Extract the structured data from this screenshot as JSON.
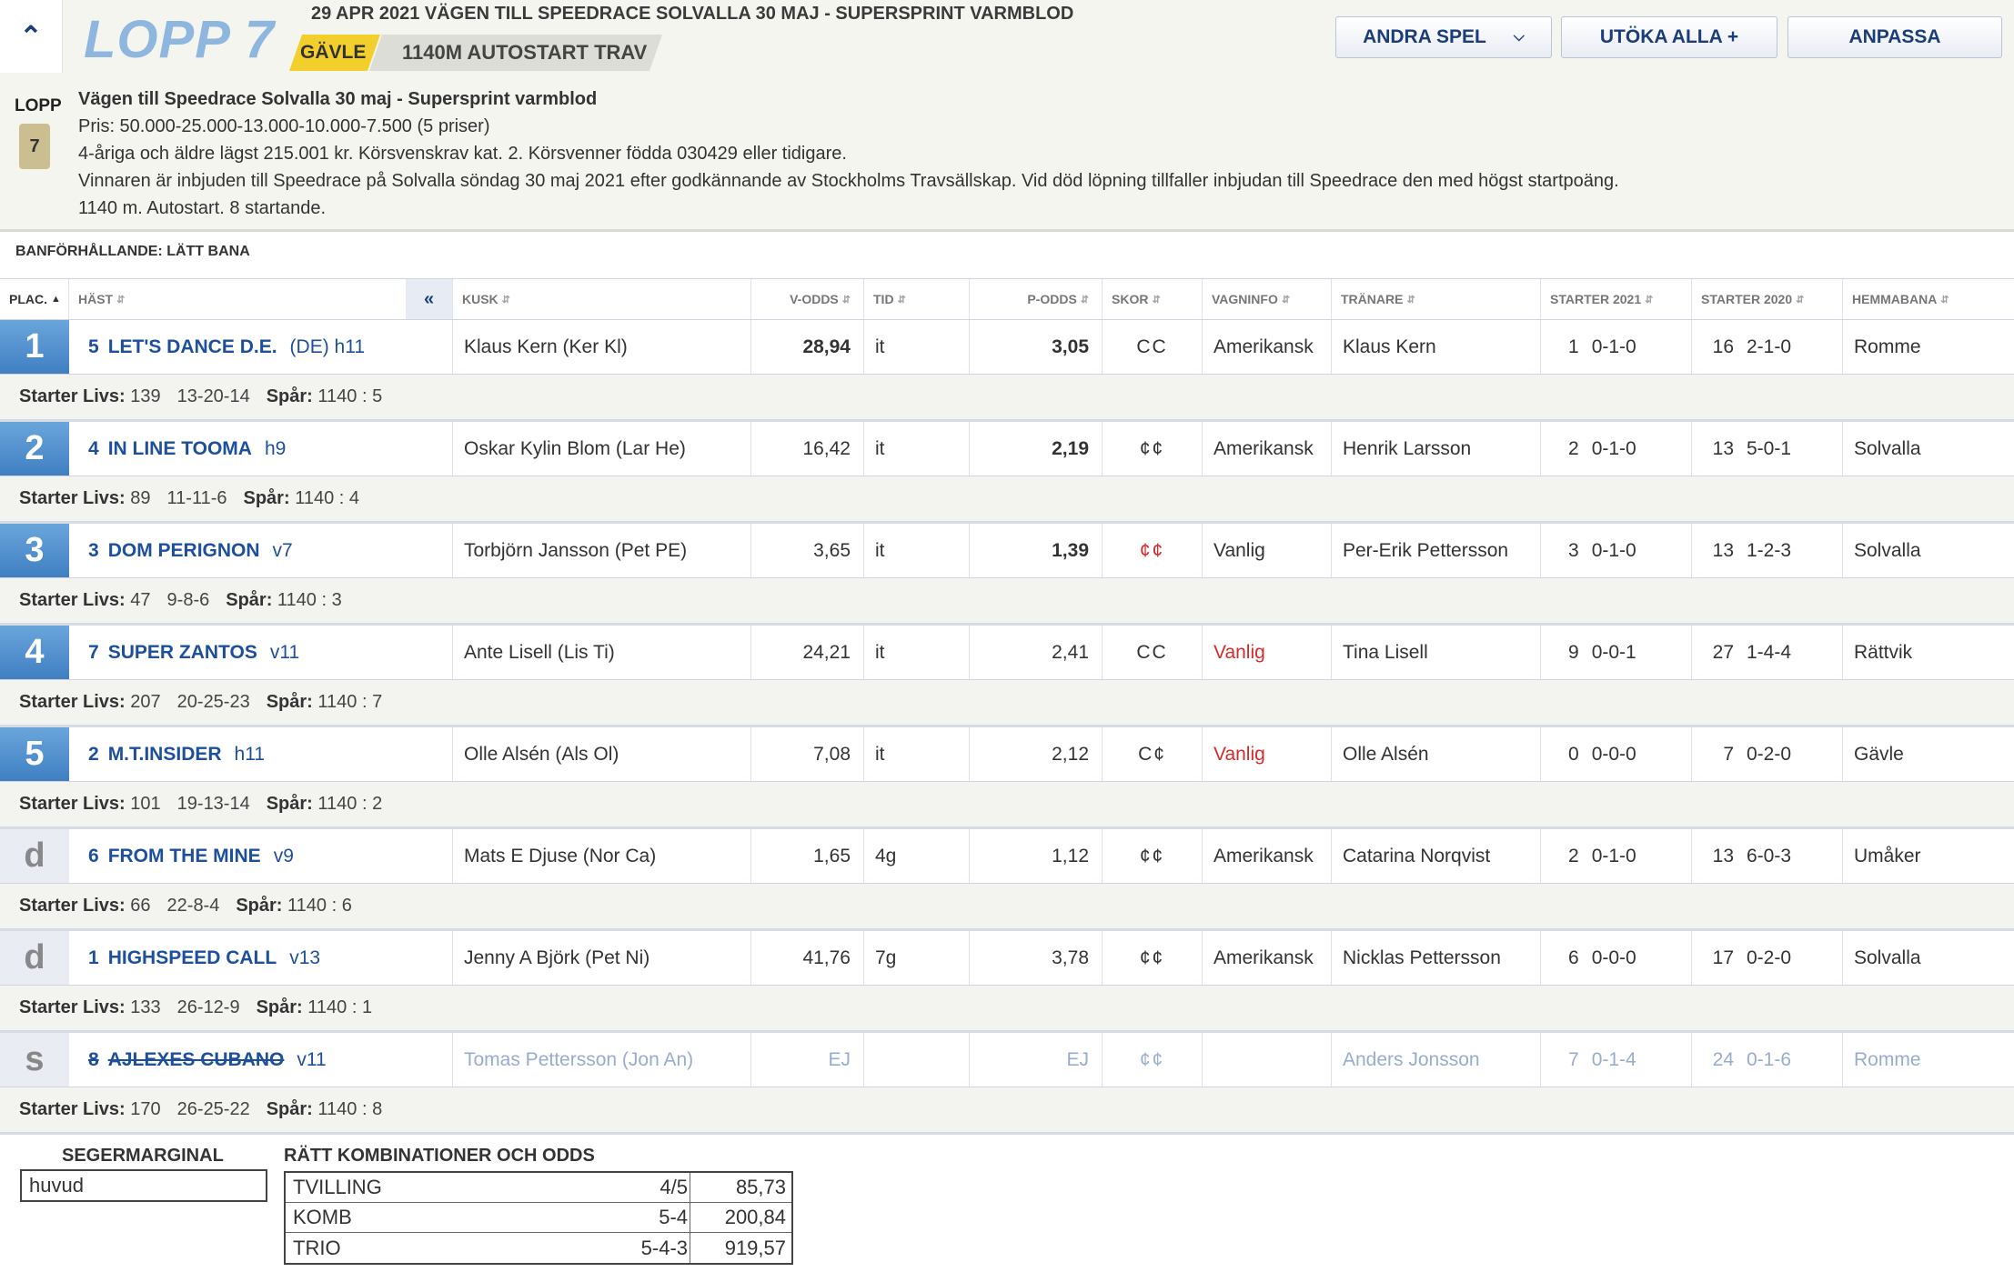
{
  "header": {
    "collapse_icon": "double-chevron-up-icon",
    "race_title": "LOPP 7",
    "race_heading": "29 APR 2021 VÄGEN TILL SPEEDRACE SOLVALLA 30 MAJ - SUPERSPRINT VARMBLOD",
    "track": "GÄVLE",
    "race_type": "1140M AUTOSTART TRAV",
    "buttons": {
      "andra": "ANDRA SPEL",
      "utoka": "UTÖKA ALLA +",
      "anpassa": "ANPASSA"
    }
  },
  "race_info": {
    "lopp_label": "LOPP",
    "lopp_number": "7",
    "title": "Vägen till Speedrace Solvalla 30 maj - Supersprint varmblod",
    "prize": "Pris: 50.000-25.000-13.000-10.000-7.500 (5 priser)",
    "conditions": "4-åriga och äldre lägst 215.001 kr. Körsvenskrav kat. 2. Körsvenner födda 030429 eller tidigare.",
    "note": "Vinnaren är inbjuden till Speedrace på Solvalla söndag 30 maj 2021 efter godkännande av Stockholms Travsällskap. Vid död löpning tillfaller inbjudan till Speedrace den med högst startpoäng.",
    "summary": "1140 m. Autostart. 8 startande."
  },
  "track_condition": "BANFÖRHÅLLANDE: LÄTT BANA",
  "columns": {
    "plac": "PLAC.",
    "hast": "HÄST",
    "back": "«",
    "kusk": "KUSK",
    "vodds": "V-ODDS",
    "tid": "TID",
    "podds": "P-ODDS",
    "skor": "SKOR",
    "vagn": "VAGNINFO",
    "tranare": "TRÄNARE",
    "s2021": "STARTER 2021",
    "s2020": "STARTER 2020",
    "hemma": "HEMMABANA"
  },
  "rows": [
    {
      "place": "1",
      "num": "5",
      "horse": "LET'S DANCE D.E.",
      "extra": "(DE)  h11",
      "driver": "Klaus Kern (Ker Kl)",
      "vodds": "28,94",
      "tid": "it",
      "podds": "3,05",
      "shoes": "CC",
      "wagon": "Amerikansk",
      "trainer": "Klaus Kern",
      "s21n": "1",
      "s21": "0-1-0",
      "s20n": "16",
      "s20": "2-1-0",
      "home": "Romme",
      "starts_label": "Starter Livs:",
      "starts": "139",
      "record": "13-20-14",
      "spar_label": "Spår:",
      "spar": "1140 : 5"
    },
    {
      "place": "2",
      "num": "4",
      "horse": "IN LINE TOOMA",
      "extra": "h9",
      "driver": "Oskar Kylin Blom (Lar He)",
      "vodds": "16,42",
      "tid": "it",
      "podds": "2,19",
      "shoes": "¢¢",
      "wagon": "Amerikansk",
      "trainer": "Henrik Larsson",
      "s21n": "2",
      "s21": "0-1-0",
      "s20n": "13",
      "s20": "5-0-1",
      "home": "Solvalla",
      "starts_label": "Starter Livs:",
      "starts": "89",
      "record": "11-11-6",
      "spar_label": "Spår:",
      "spar": "1140 : 4"
    },
    {
      "place": "3",
      "num": "3",
      "horse": "DOM PERIGNON",
      "extra": "v7",
      "driver": "Torbjörn Jansson (Pet PE)",
      "vodds": "3,65",
      "tid": "it",
      "podds": "1,39",
      "shoes": "¢¢",
      "wagon": "Vanlig",
      "trainer": "Per-Erik Pettersson",
      "s21n": "3",
      "s21": "0-1-0",
      "s20n": "13",
      "s20": "1-2-3",
      "home": "Solvalla",
      "starts_label": "Starter Livs:",
      "starts": "47",
      "record": "9-8-6",
      "spar_label": "Spår:",
      "spar": "1140 : 3"
    },
    {
      "place": "4",
      "num": "7",
      "horse": "SUPER ZANTOS",
      "extra": "v11",
      "driver": "Ante Lisell (Lis Ti)",
      "vodds": "24,21",
      "tid": "it",
      "podds": "2,41",
      "shoes": "CC",
      "wagon": "Vanlig",
      "trainer": "Tina Lisell",
      "s21n": "9",
      "s21": "0-0-1",
      "s20n": "27",
      "s20": "1-4-4",
      "home": "Rättvik",
      "starts_label": "Starter Livs:",
      "starts": "207",
      "record": "20-25-23",
      "spar_label": "Spår:",
      "spar": "1140 : 7"
    },
    {
      "place": "5",
      "num": "2",
      "horse": "M.T.INSIDER",
      "extra": "h11",
      "driver": "Olle Alsén (Als Ol)",
      "vodds": "7,08",
      "tid": "it",
      "podds": "2,12",
      "shoes": "C¢",
      "wagon": "Vanlig",
      "trainer": "Olle Alsén",
      "s21n": "0",
      "s21": "0-0-0",
      "s20n": "7",
      "s20": "0-2-0",
      "home": "Gävle",
      "starts_label": "Starter Livs:",
      "starts": "101",
      "record": "19-13-14",
      "spar_label": "Spår:",
      "spar": "1140 : 2"
    },
    {
      "place": "d",
      "num": "6",
      "horse": "FROM THE MINE",
      "extra": "v9",
      "driver": "Mats E Djuse (Nor Ca)",
      "vodds": "1,65",
      "tid": "4g",
      "podds": "1,12",
      "shoes": "¢¢",
      "wagon": "Amerikansk",
      "trainer": "Catarina Norqvist",
      "s21n": "2",
      "s21": "0-1-0",
      "s20n": "13",
      "s20": "6-0-3",
      "home": "Umåker",
      "starts_label": "Starter Livs:",
      "starts": "66",
      "record": "22-8-4",
      "spar_label": "Spår:",
      "spar": "1140 : 6"
    },
    {
      "place": "d",
      "num": "1",
      "horse": "HIGHSPEED CALL",
      "extra": "v13",
      "driver": "Jenny A Björk (Pet Ni)",
      "vodds": "41,76",
      "tid": "7g",
      "podds": "3,78",
      "shoes": "¢¢",
      "wagon": "Amerikansk",
      "trainer": "Nicklas Pettersson",
      "s21n": "6",
      "s21": "0-0-0",
      "s20n": "17",
      "s20": "0-2-0",
      "home": "Solvalla",
      "starts_label": "Starter Livs:",
      "starts": "133",
      "record": "26-12-9",
      "spar_label": "Spår:",
      "spar": "1140 : 1"
    },
    {
      "place": "s",
      "num": "8",
      "horse": "AJLEXES CUBANO",
      "extra": "v11",
      "driver": "Tomas Pettersson (Jon An)",
      "vodds": "EJ",
      "tid": "",
      "podds": "EJ",
      "shoes": "¢¢",
      "wagon": "",
      "trainer": "Anders Jonsson",
      "s21n": "7",
      "s21": "0-1-4",
      "s20n": "24",
      "s20": "0-1-6",
      "home": "Romme",
      "starts_label": "Starter Livs:",
      "starts": "170",
      "record": "26-25-22",
      "spar_label": "Spår:",
      "spar": "1140 : 8"
    }
  ],
  "bottom": {
    "seg_label": "SEGERMARGINAL",
    "seg_value": "huvud",
    "komb_label": "RÄTT KOMBINATIONER OCH ODDS",
    "komb": [
      {
        "name": "TVILLING",
        "comb": "4/5",
        "odds": "85,73"
      },
      {
        "name": "KOMB",
        "comb": "5-4",
        "odds": "200,84"
      },
      {
        "name": "TRIO",
        "comb": "5-4-3",
        "odds": "919,57"
      }
    ]
  },
  "colors": {
    "accent": "#1e4f9c",
    "place_top": "#3f7fc2",
    "track_tag": "#f2cf2c",
    "warn": "#d62a2a"
  }
}
